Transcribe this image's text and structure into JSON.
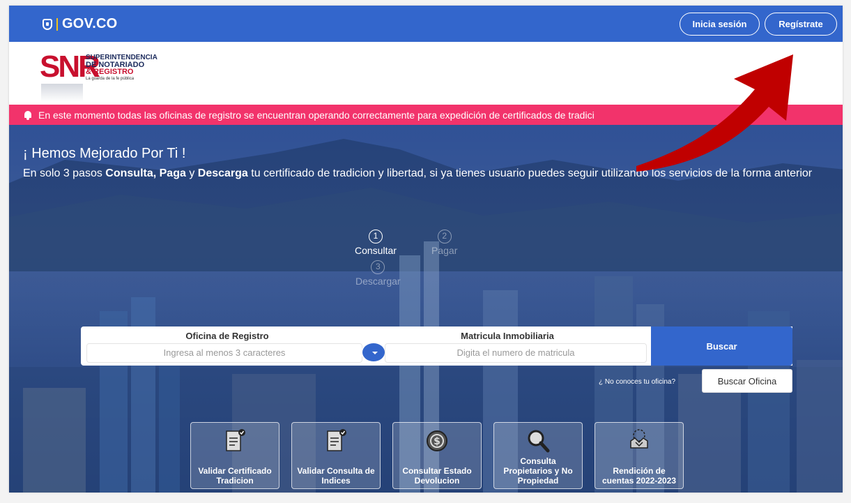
{
  "gov": {
    "logo_text": "GOV.CO",
    "login_label": "Inicia sesión",
    "register_label": "Regístrate"
  },
  "snr": {
    "letters": "SNR",
    "line1": "SUPERINTENDENCIA",
    "line2": "DE NOTARIADO",
    "line3": "& REGISTRO",
    "line4": "La guarda de la fe pública"
  },
  "alert": {
    "text": "En este momento todas las oficinas de registro se encuentran operando correctamente para expedición de certificados de tradici"
  },
  "hero": {
    "title": "¡ Hemos Mejorado Por Ti !",
    "sub_1": "En solo 3 pasos ",
    "sub_b1": "Consulta, Paga",
    "sub_2": " y ",
    "sub_b2": "Descarga",
    "sub_3": " tu certificado de tradicion y libertad, si ya tienes usuario puedes seguir utilizando los servicios de la forma anterior"
  },
  "steps": [
    {
      "num": "1",
      "label": "Consultar"
    },
    {
      "num": "2",
      "label": "Pagar"
    },
    {
      "num": "3",
      "label": "Descargar"
    }
  ],
  "search": {
    "office_label": "Oficina de Registro",
    "office_placeholder": "Ingresa al menos 3 caracteres",
    "matricula_label": "Matricula Inmobiliaria",
    "matricula_placeholder": "Digita el numero de matricula",
    "search_button": "Buscar",
    "office_question": "¿ No conoces tu oficina?",
    "office_button": "Buscar Oficina"
  },
  "tiles": [
    {
      "label": "Validar Certificado Tradicion",
      "icon": "certificate-check-icon"
    },
    {
      "label": "Validar Consulta de Indices",
      "icon": "document-check-icon"
    },
    {
      "label": "Consultar Estado Devolucion",
      "icon": "money-circle-icon"
    },
    {
      "label": "Consulta Propietarios y No Propiedad",
      "icon": "magnifier-icon"
    },
    {
      "label": "Rendición de cuentas 2022-2023",
      "icon": "handshake-icon"
    }
  ],
  "colors": {
    "gov_blue": "#3366cc",
    "alert_pink": "#f2336b",
    "snr_red": "#c8102e",
    "arrow_red": "#c00000"
  }
}
